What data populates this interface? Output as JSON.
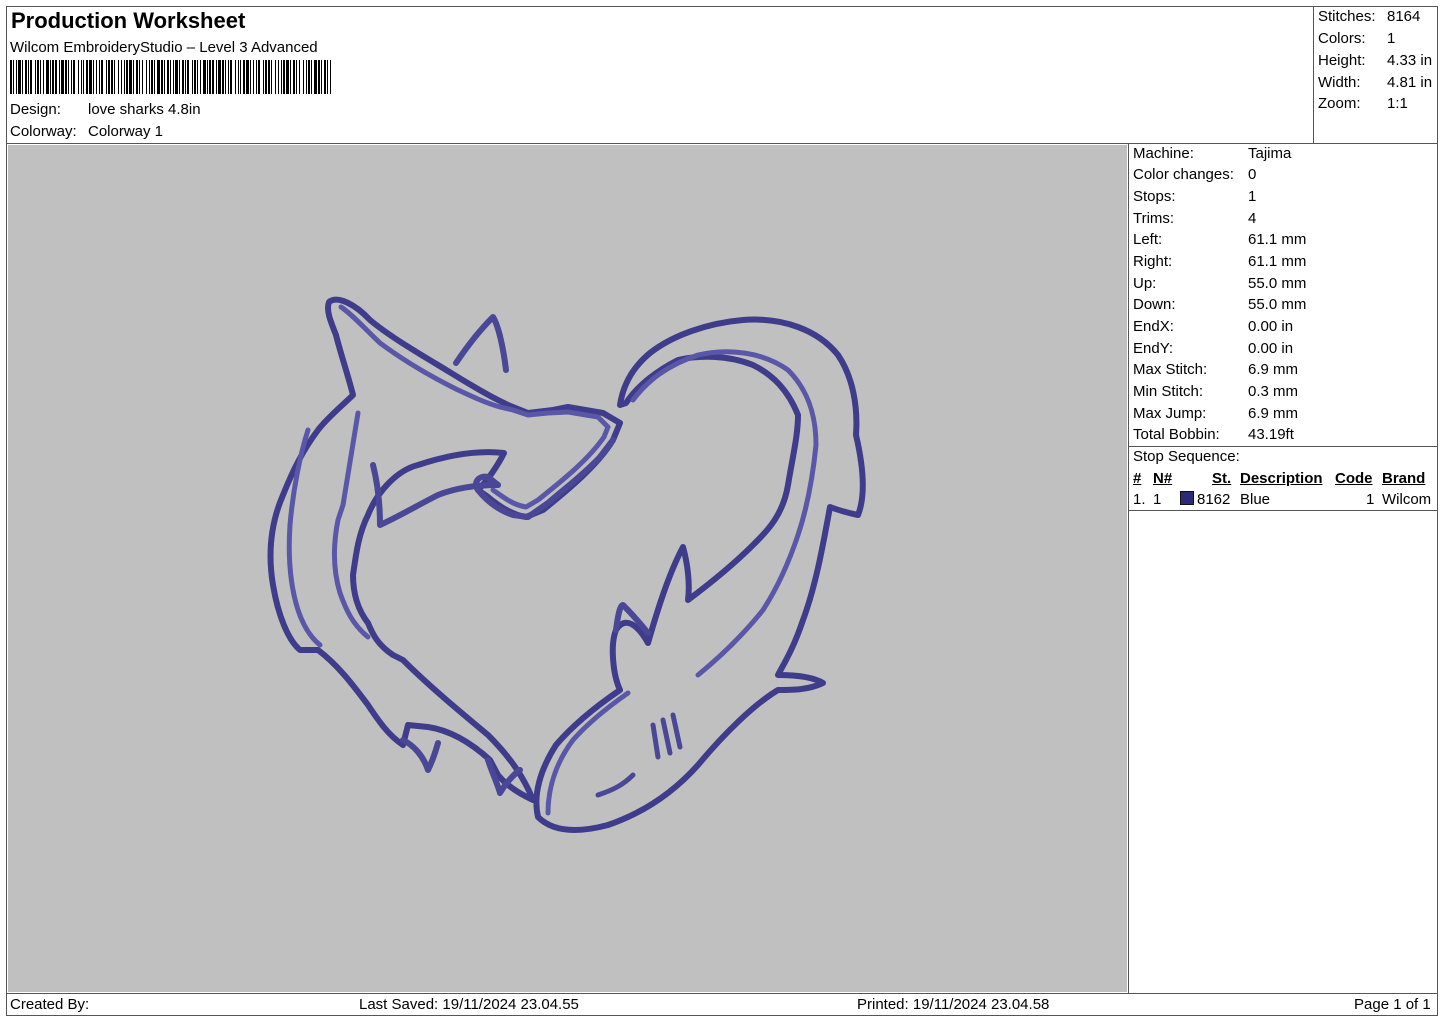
{
  "header": {
    "title": "Production Worksheet",
    "software": "Wilcom EmbroideryStudio – Level 3 Advanced",
    "design_label": "Design:",
    "design_value": "love sharks 4.8in",
    "colorway_label": "Colorway:",
    "colorway_value": "Colorway 1"
  },
  "summary": [
    {
      "label": "Stitches:",
      "value": "8164"
    },
    {
      "label": "Colors:",
      "value": "1"
    },
    {
      "label": "Height:",
      "value": "4.33 in"
    },
    {
      "label": "Width:",
      "value": "4.81 in"
    },
    {
      "label": "Zoom:",
      "value": "1:1"
    }
  ],
  "machine_info": [
    {
      "label": "Machine:",
      "value": "Tajima"
    },
    {
      "label": "Color changes:",
      "value": "0"
    },
    {
      "label": "Stops:",
      "value": "1"
    },
    {
      "label": "Trims:",
      "value": "4"
    },
    {
      "label": "Left:",
      "value": "61.1 mm"
    },
    {
      "label": "Right:",
      "value": "61.1 mm"
    },
    {
      "label": "Up:",
      "value": "55.0 mm"
    },
    {
      "label": "Down:",
      "value": "55.0 mm"
    },
    {
      "label": "EndX:",
      "value": "0.00 in"
    },
    {
      "label": "EndY:",
      "value": "0.00 in"
    },
    {
      "label": "Max Stitch:",
      "value": "6.9 mm"
    },
    {
      "label": "Min Stitch:",
      "value": "0.3 mm"
    },
    {
      "label": "Max Jump:",
      "value": "6.9 mm"
    },
    {
      "label": "Total Bobbin:",
      "value": "43.19ft"
    }
  ],
  "stop_sequence": {
    "title": "Stop Sequence:",
    "columns": [
      "#",
      "N#",
      "St.",
      "Description",
      "Code",
      "Brand"
    ],
    "rows": [
      {
        "index": "1.",
        "n": "1",
        "st": "8162",
        "description": "Blue",
        "code": "1",
        "brand": "Wilcom",
        "color": "#2b2a7a"
      }
    ]
  },
  "design_colors": {
    "thread": "#5a57a8",
    "thread_dark": "#3f3c8c",
    "background": "#c0c0c0"
  },
  "footer": {
    "created_by": "Created By:",
    "last_saved": "Last Saved: 19/11/2024 23.04.55",
    "printed": "Printed: 19/11/2024 23.04.58",
    "page": "Page 1 of 1"
  }
}
